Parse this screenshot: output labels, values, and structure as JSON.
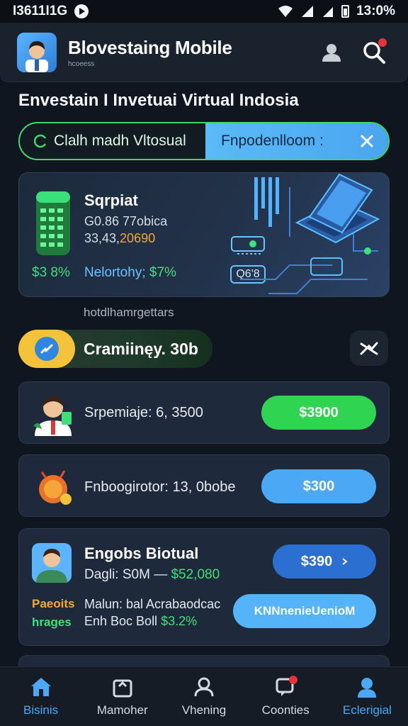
{
  "status": {
    "left_text": "I3611I1G",
    "time": "13:​0%"
  },
  "header": {
    "title": "Blovestaing Mobile",
    "subtitle": "​hcoeess",
    "icons": [
      "person-icon",
      "search-icon"
    ]
  },
  "page_title": "Envestain I Invetuai Virtual Indosia",
  "toggle": {
    "left_label": "Clalh madh Vltosual",
    "right_label": "Fnpodenlloom",
    "right_suffix": ":"
  },
  "hero": {
    "title": "Sqrpiat",
    "line1": "G0.86 77obica",
    "line2_main": "3​3,43,",
    "line2_accent": "20690",
    "pct": "$3 8%",
    "label_main": "Nelortohy; ",
    "label_green": "$7%",
    "chip": "Q6'8"
  },
  "section_hint": "hotdlhamrgettars",
  "promo": {
    "label": "Cramiinęy. 30b"
  },
  "rows": [
    {
      "text": "Srpemiaje: 6, 3500",
      "button": "$3900"
    },
    {
      "text": "Fnboogirotor: 13, 0bobe",
      "button": "$300"
    }
  ],
  "feature": {
    "title": "Engobs Biotual",
    "sub_main": "Dagli: S0M — ",
    "sub_green": "$52,080",
    "button": "$390",
    "left_tag_1": "Paeoits",
    "left_tag_2": "hrages",
    "detail_1": "Malun: bal Acrabaodcac",
    "detail_2_main": "Enh Boc Boll ",
    "detail_2_green": "$3.2%",
    "wide_button": "KNNnenieUenioM"
  },
  "nav": [
    {
      "label": "Bisinis",
      "icon": "home-icon",
      "active": true
    },
    {
      "label": "Mamoher",
      "icon": "inbox-icon",
      "active": false
    },
    {
      "label": "Vhening",
      "icon": "profile-icon",
      "active": false
    },
    {
      "label": "Coonties",
      "icon": "chat-icon",
      "active": false
    },
    {
      "label": "Eclerigial",
      "icon": "user-icon",
      "active": true
    }
  ],
  "colors": {
    "accent_green": "#2fd451",
    "accent_blue": "#4aa8f5",
    "background": "#10161f"
  }
}
